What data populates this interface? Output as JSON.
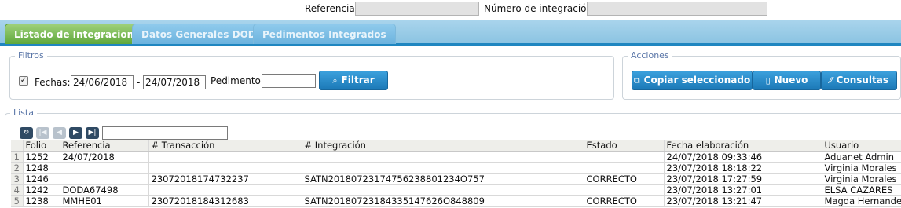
{
  "header": {
    "referencia_label": "Referencia:",
    "referencia_value": "",
    "numero_integracion_label": "Número de integración:",
    "numero_integracion_value": ""
  },
  "tabs": [
    {
      "label": "Listado de Integraciones",
      "active": true
    },
    {
      "label": "Datos Generales DODA",
      "active": false
    },
    {
      "label": "Pedimentos Integrados",
      "active": false
    }
  ],
  "filtros": {
    "legend": "Filtros",
    "fechas_checked": true,
    "fechas_label": "Fechas:",
    "fecha_desde": "24/06/2018",
    "separator": "-",
    "fecha_hasta": "24/07/2018",
    "pedimento_label": "Pedimento:",
    "pedimento_value": "",
    "filtrar_label": "Filtrar"
  },
  "acciones": {
    "legend": "Acciones",
    "copiar_label": "Copiar seleccionado",
    "nuevo_label": "Nuevo",
    "consultas_label": "Consultas"
  },
  "lista": {
    "legend": "Lista",
    "search_value": "",
    "columns": [
      "Folio",
      "Referencia",
      "# Transacción",
      "# Integración",
      "Estado",
      "Fecha elaboración",
      "Usuario"
    ],
    "rows": [
      {
        "n": "1",
        "cells": [
          "1252",
          "24/07/2018",
          "",
          "",
          "",
          "24/07/2018 09:33:46",
          "Aduanet Admin"
        ]
      },
      {
        "n": "2",
        "cells": [
          "1248",
          "",
          "",
          "",
          "",
          "23/07/2018 18:18:22",
          "Virginia Morales"
        ]
      },
      {
        "n": "3",
        "cells": [
          "1246",
          "",
          "23072018174732237",
          "SATN20180723174756238801234O757",
          "CORRECTO",
          "23/07/2018 17:27:59",
          "Virginia Morales"
        ]
      },
      {
        "n": "4",
        "cells": [
          "1242",
          "DODA67498",
          "",
          "",
          "",
          "23/07/2018 13:27:01",
          "ELSA CAZARES"
        ]
      },
      {
        "n": "5",
        "cells": [
          "1238",
          "MMHE01",
          "23072018184312683",
          "SATN20180723184335147626O848809",
          "CORRECTO",
          "23/07/2018 13:21:47",
          "Magda Hernandez"
        ]
      }
    ]
  },
  "colors": {
    "tab_active": "#5fa83b",
    "tab_strip": "#8cc4e2",
    "button": "#1c79b7",
    "legend_text": "#5a76a8"
  },
  "icons": {
    "checkbox": "check-icon",
    "filtrar": "search-icon",
    "copiar": "copy-icon",
    "nuevo": "document-icon",
    "consultas": "wand-icon",
    "refresh": "refresh-icon",
    "first": "first-page-icon",
    "prev": "prev-page-icon",
    "next": "next-page-icon",
    "last": "last-page-icon"
  }
}
